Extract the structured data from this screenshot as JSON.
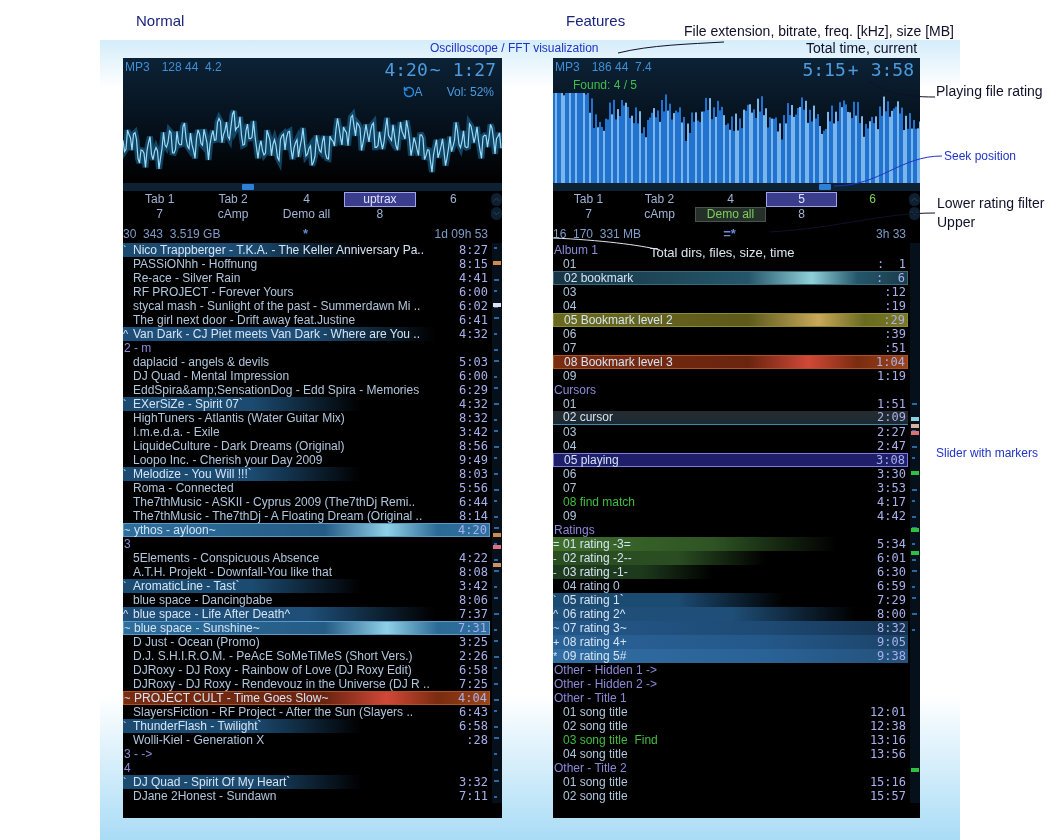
{
  "annotations": [
    {
      "text": "Oscilloscope / FFT visualization",
      "color": "#1f33c8"
    },
    {
      "text": "File extension, bitrate, freq. [kHz], size [MB]",
      "color": "#10102a"
    },
    {
      "text": "Total time, current",
      "color": "#10102a"
    },
    {
      "text": "Playing file rating",
      "color": "#10102a"
    },
    {
      "text": "Seek position",
      "color": "#1f33c8"
    },
    {
      "text": "Lower rating filter",
      "color": "#10102a"
    },
    {
      "text": "Upper",
      "color": "#10102a"
    },
    {
      "text": "Total dirs, files, size, time",
      "color": "#dde6f0"
    },
    {
      "text": "Slider with markers",
      "color": "#1f33c8"
    }
  ],
  "panels": [
    {
      "heading": "Normal",
      "format": "MP3",
      "details": "128 44  4.2",
      "total_time": "4:20",
      "rating_mark": "~",
      "current_time": "1:27",
      "repeat_mode": "A",
      "volume": "Vol: 52%",
      "visualization": {
        "kind": "oscilloscope"
      },
      "seek": {
        "level": 0.33
      },
      "tabs": [
        {
          "label": "Tab 1",
          "selected": false,
          "found": false,
          "active": false
        },
        {
          "label": "Tab 2",
          "selected": false,
          "found": false,
          "active": false
        },
        {
          "label": "4",
          "selected": false,
          "found": false,
          "active": false
        },
        {
          "label": "uptrax",
          "selected": true,
          "found": false,
          "active": false
        },
        {
          "label": "6",
          "selected": false,
          "found": false,
          "active": false
        },
        {
          "label": "7",
          "selected": false,
          "found": false,
          "active": false
        },
        {
          "label": "cAmp",
          "selected": false,
          "found": false,
          "active": false
        },
        {
          "label": "Demo all",
          "selected": false,
          "found": false,
          "active": false
        },
        {
          "label": "8",
          "selected": false,
          "found": false,
          "active": false
        }
      ],
      "stats": {
        "totals": "30  343  3.519 GB",
        "rating_filter": "*",
        "total_time": "1d 09h 53"
      },
      "rows": [
        {
          "kind": "rating1",
          "mark": "`",
          "text": "Nico Trappberger - T.K.A. - The Keller Anniversary Pa..",
          "time": "8:27"
        },
        {
          "kind": "none",
          "text": "PASSiONhh - Hoffnung",
          "time": "8:15"
        },
        {
          "kind": "none",
          "text": "Re-ace - Silver Rain",
          "time": "4:41"
        },
        {
          "kind": "none",
          "text": "RF PROJECT - Forever Yours",
          "time": "6:00"
        },
        {
          "kind": "none",
          "text": "stycal mash - Sunlight of the past - Summerdawn Mi ..",
          "time": "6:02"
        },
        {
          "kind": "none",
          "text": "The girl next door - Drift away feat.Justine",
          "time": "6:41"
        },
        {
          "kind": "rating2",
          "mark": "^",
          "text": "Van Dark - CJ Piet meets Van Dark - Where are You ..",
          "time": "4:32"
        },
        {
          "kind": "header",
          "text": "2 - m"
        },
        {
          "kind": "none",
          "text": "daplacid - angels & devils",
          "time": "5:03"
        },
        {
          "kind": "none",
          "text": "DJ Quad - Mental Impression",
          "time": "6:00"
        },
        {
          "kind": "none",
          "text": "EddSpira&amp;SensationDog - Edd Spira - Memories",
          "time": "6:29"
        },
        {
          "kind": "rating1",
          "mark": "`",
          "text": "EXerSiZe - Spirit 07`",
          "time": "4:32"
        },
        {
          "kind": "none",
          "text": "HighTuners - Atlantis (Water Guitar Mix)",
          "time": "8:32"
        },
        {
          "kind": "none",
          "text": "I.m.e.d.a. - Exile",
          "time": "3:42"
        },
        {
          "kind": "none",
          "text": "LiquideCulture - Dark Dreams (Original)",
          "time": "8:56"
        },
        {
          "kind": "none",
          "text": "Loopo Inc. - Cherish your Day 2009",
          "time": "9:49"
        },
        {
          "kind": "rating1",
          "mark": "`",
          "text": "Melodize - You Will !!!`",
          "time": "8:03"
        },
        {
          "kind": "none",
          "text": "Roma - Connected",
          "time": "5:56"
        },
        {
          "kind": "none",
          "text": "The7thMusic - ASKII - Cyprus 2009 (The7thDj Remi..",
          "time": "6:44"
        },
        {
          "kind": "none",
          "text": "The7thMusic - The7thDj - A Floating Dream (Original ..",
          "time": "8:14"
        },
        {
          "kind": "glow",
          "mark": "~",
          "text": "ythos - ayloon~",
          "time": "4:20"
        },
        {
          "kind": "header",
          "text": "3"
        },
        {
          "kind": "none",
          "text": "5Elements - Conspicuous Absence",
          "time": "4:22"
        },
        {
          "kind": "none",
          "text": "A.T.H. Projekt - Downfall-You like that",
          "time": "8:08"
        },
        {
          "kind": "rating1",
          "mark": "`",
          "text": "AromaticLine - Tast`",
          "time": "3:42"
        },
        {
          "kind": "none",
          "text": "blue space - Dancingbabe",
          "time": "8:06"
        },
        {
          "kind": "rating2",
          "mark": "^",
          "text": "blue space - Life After Death^",
          "time": "7:37"
        },
        {
          "kind": "glow",
          "mark": "~",
          "text": "blue space - Sunshine~",
          "time": "7:31"
        },
        {
          "kind": "none",
          "text": "D Just - Ocean (Promo)",
          "time": "3:25"
        },
        {
          "kind": "none",
          "text": "D.J. S.H.I.R.O.M. - PeAcE SoMeTiMeS (Short Vers.)",
          "time": "2:26"
        },
        {
          "kind": "none",
          "text": "DJRoxy - DJ Roxy - Rainbow of Love (DJ Roxy Edit)",
          "time": "6:58"
        },
        {
          "kind": "none",
          "text": "DJRoxy - DJ Roxy - Rendevouz in the Universe (DJ R ..",
          "time": "7:25"
        },
        {
          "kind": "bookmark3",
          "mark": "~",
          "text": "PROJECT CULT - Time Goes Slow~",
          "time": "4:04"
        },
        {
          "kind": "none",
          "text": "SlayersFiction - RF Project - After the Sun (Slayers ..",
          "time": "6:43"
        },
        {
          "kind": "rating1",
          "mark": "`",
          "text": "ThunderFlash - Twilight`",
          "time": "6:58"
        },
        {
          "kind": "none",
          "text": "Wolli-Kiel - Generation X",
          "time": ":28"
        },
        {
          "kind": "header",
          "text": "3 - ->"
        },
        {
          "kind": "header",
          "text": "4"
        },
        {
          "kind": "rating1",
          "mark": "`",
          "text": "DJ Quad - Spirit Of My Heart`",
          "time": "3:32"
        },
        {
          "kind": "none",
          "text": "DJane 2Honest - Sundawn",
          "time": "7:11"
        }
      ]
    },
    {
      "heading": "Features",
      "format": "MP3",
      "details": "186 44  7.4",
      "total_time": "5:15",
      "rating_mark": "+",
      "current_time": "3:58",
      "found": "Found: 4 / 5",
      "visualization": {
        "kind": "fft"
      },
      "seek": {
        "level": 0.74
      },
      "tabs": [
        {
          "label": "Tab 1",
          "selected": false,
          "found": false,
          "active": false
        },
        {
          "label": "Tab 2",
          "selected": false,
          "found": false,
          "active": false
        },
        {
          "label": "4",
          "selected": false,
          "found": false,
          "active": false
        },
        {
          "label": "5",
          "selected": true,
          "found": false,
          "active": false
        },
        {
          "label": "6",
          "selected": false,
          "found": true,
          "active": false
        },
        {
          "label": "7",
          "selected": false,
          "found": false,
          "active": false
        },
        {
          "label": "cAmp",
          "selected": false,
          "found": false,
          "active": false
        },
        {
          "label": "Demo all",
          "selected": false,
          "found": true,
          "active": true
        },
        {
          "label": "8",
          "selected": false,
          "found": false,
          "active": false
        }
      ],
      "stats": {
        "totals": "16  170  331 MB",
        "rating_filter": "=*",
        "total_time": "3h 33"
      },
      "rows": [
        {
          "kind": "header",
          "text": "Album 1"
        },
        {
          "kind": "none",
          "text": "01",
          "time": ":  1"
        },
        {
          "kind": "bookmark1",
          "text": "02 bookmark",
          "time": ":  6"
        },
        {
          "kind": "none",
          "text": "03",
          "time": ":12"
        },
        {
          "kind": "none",
          "text": "04",
          "time": ":19"
        },
        {
          "kind": "bookmark2",
          "text": "05 Bookmark level 2",
          "time": ":29"
        },
        {
          "kind": "none",
          "text": "06",
          "time": ":39"
        },
        {
          "kind": "none",
          "text": "07",
          "time": ":51"
        },
        {
          "kind": "bookmark3",
          "text": "08 Bookmark level 3",
          "time": "1:04"
        },
        {
          "kind": "none",
          "text": "09",
          "time": "1:19"
        },
        {
          "kind": "header",
          "text": "Cursors"
        },
        {
          "kind": "none",
          "text": "01",
          "time": "1:51"
        },
        {
          "kind": "cursor",
          "text": "02 cursor",
          "time": "2:09"
        },
        {
          "kind": "none",
          "text": "03",
          "time": "2:27"
        },
        {
          "kind": "none",
          "text": "04",
          "time": "2:47"
        },
        {
          "kind": "playing",
          "text": "05 playing",
          "time": "3:08"
        },
        {
          "kind": "none",
          "text": "06",
          "time": "3:30"
        },
        {
          "kind": "none",
          "text": "07",
          "time": "3:53"
        },
        {
          "kind": "found",
          "text": "08 find match",
          "time": "4:17"
        },
        {
          "kind": "none",
          "text": "09",
          "time": "4:42"
        },
        {
          "kind": "header",
          "text": "Ratings"
        },
        {
          "kind": "rating-3",
          "mark": "=",
          "text": "01 rating -3=",
          "time": "5:34"
        },
        {
          "kind": "rating-2",
          "mark": "-",
          "text": "02 rating -2--",
          "time": "6:01"
        },
        {
          "kind": "rating-1",
          "mark": "-",
          "text": "03 rating -1-",
          "time": "6:30"
        },
        {
          "kind": "none",
          "text": "04 rating 0",
          "time": "6:59"
        },
        {
          "kind": "rating1",
          "mark": "`",
          "text": "05 rating 1`",
          "time": "7:29"
        },
        {
          "kind": "rating2",
          "mark": "^",
          "text": "06 rating 2^",
          "time": "8:00"
        },
        {
          "kind": "rating3",
          "mark": "~",
          "text": "07 rating 3~",
          "time": "8:32"
        },
        {
          "kind": "rating4",
          "mark": "+",
          "text": "08 rating 4+",
          "time": "9:05"
        },
        {
          "kind": "rating5",
          "mark": "*",
          "text": "09 rating 5#",
          "time": "9:38"
        },
        {
          "kind": "header",
          "text": "Other - Hidden 1 ->"
        },
        {
          "kind": "header",
          "text": "Other - Hidden 2 ->"
        },
        {
          "kind": "header",
          "text": "Other - Title 1"
        },
        {
          "kind": "none",
          "text": "01 song title",
          "time": "12:01"
        },
        {
          "kind": "none",
          "text": "02 song title",
          "time": "12:38"
        },
        {
          "kind": "found",
          "text": "03 song title  Find",
          "time": "13:16"
        },
        {
          "kind": "none",
          "text": "04 song title",
          "time": "13:56"
        },
        {
          "kind": "header",
          "text": "Other - Title 2"
        },
        {
          "kind": "none",
          "text": "01 song title",
          "time": "15:16"
        },
        {
          "kind": "none",
          "text": "02 song title",
          "time": "15:57"
        }
      ]
    }
  ]
}
